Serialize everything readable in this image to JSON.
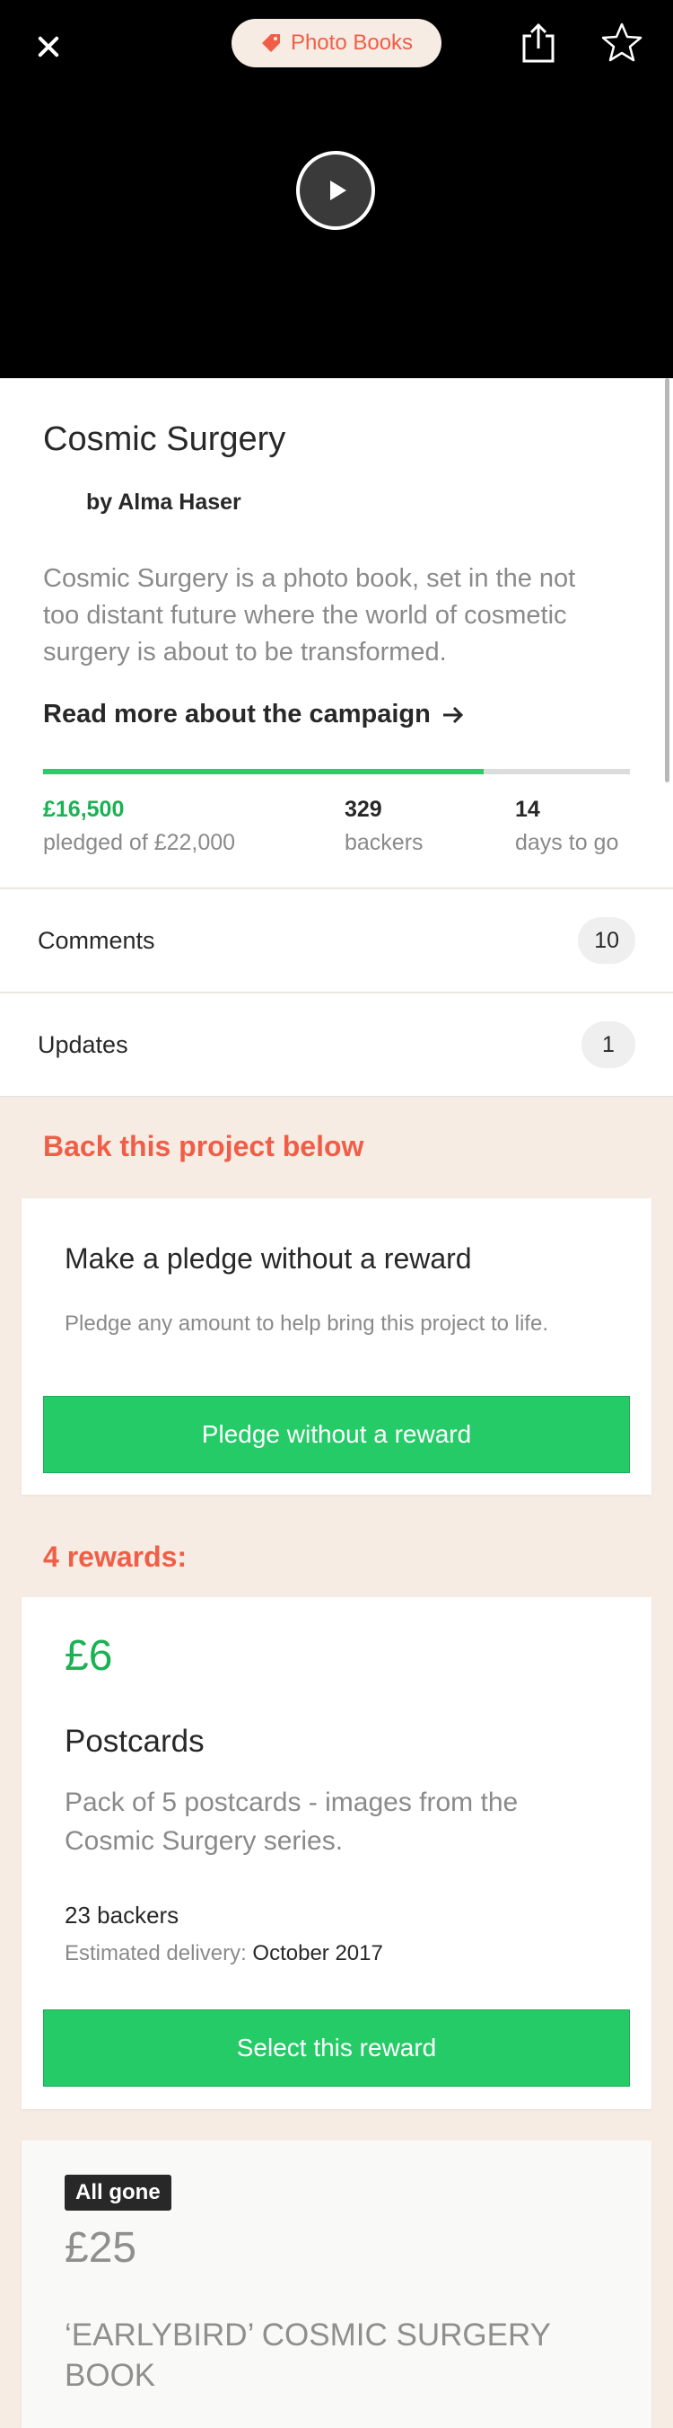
{
  "header": {
    "category": "Photo Books",
    "icons": [
      "close-icon",
      "tag-icon",
      "share-icon",
      "star-icon",
      "play-icon"
    ]
  },
  "project": {
    "title": "Cosmic Surgery",
    "creator": "by Alma Haser",
    "blurb": "Cosmic Surgery is a photo book, set in the not too distant future where the world of cosmetic surgery is about to be transformed.",
    "read_more": "Read more about the campaign",
    "progress_fraction": 0.75,
    "pledged": "£16,500",
    "pledged_label": "pledged of £22,000",
    "backers": "329",
    "backers_label": "backers",
    "days": "14",
    "days_label": "days to go"
  },
  "rows": {
    "comments_label": "Comments",
    "comments_count": "10",
    "updates_label": "Updates",
    "updates_count": "1"
  },
  "back": {
    "heading": "Back this project below",
    "no_reward_title": "Make a pledge without a reward",
    "no_reward_desc": "Pledge any amount to help bring this project to life.",
    "no_reward_button": "Pledge without a reward"
  },
  "rewards": {
    "heading": "4 rewards:",
    "items": [
      {
        "price": "£6",
        "title": "Postcards",
        "description": "Pack of 5 postcards - images from the Cosmic Surgery series.",
        "backers": "23 backers",
        "delivery_label": "Estimated delivery:",
        "delivery_value": "October 2017",
        "button": "Select this reward"
      },
      {
        "badge": "All gone",
        "price": "£25",
        "title": "‘EARLYBIRD’ COSMIC SURGERY BOOK"
      }
    ]
  },
  "colors": {
    "accent": "#f05e47",
    "green": "#25cb67",
    "green_text": "#1bb253",
    "cream": "#f6ece3"
  }
}
